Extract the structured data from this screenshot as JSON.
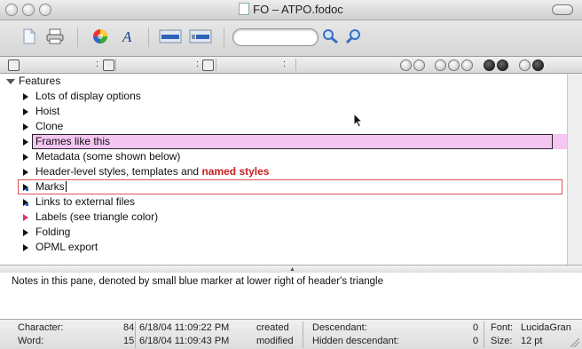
{
  "window": {
    "title": "FO – ATPO.fodoc"
  },
  "toolbar": {
    "icons": [
      "new-document-icon",
      "print-icon",
      "colors-icon",
      "fonts-icon",
      "insert-row-icon",
      "insert-child-icon",
      "search-field",
      "find-icon",
      "find-next-icon"
    ]
  },
  "columns": {
    "sep1": ":",
    "sep2": ":",
    "sep3": ":"
  },
  "outline": {
    "root": "Features",
    "rows": [
      {
        "label": "Lots of display options"
      },
      {
        "label": "Hoist"
      },
      {
        "label": "Clone"
      },
      {
        "label": "Frames like this"
      },
      {
        "label": "Metadata (some shown below)"
      },
      {
        "label": "Header-level styles, templates and ",
        "emphasis": "named styles"
      },
      {
        "label": "Marks"
      },
      {
        "label": "Links to external files"
      },
      {
        "label": "Labels (see triangle color)"
      },
      {
        "label": "Folding"
      },
      {
        "label": "OPML export"
      }
    ]
  },
  "notes": {
    "text": "Notes in this pane, denoted by small blue marker at lower right of header's triangle"
  },
  "status": {
    "char_label": "Character:",
    "char_value": "84",
    "word_label": "Word:",
    "word_value": "15",
    "created_date": "6/18/04 11:09:22 PM",
    "created_label": "created",
    "modified_date": "6/18/04 11:09:43 PM",
    "modified_label": "modified",
    "desc_label": "Descendant:",
    "desc_value": "0",
    "hidden_label": "Hidden descendant:",
    "hidden_value": "0",
    "font_label": "Font:",
    "font_value": "LucidaGran",
    "size_label": "Size:",
    "size_value": "12 pt"
  },
  "colors": {
    "frame_fill": "#f6c6f2",
    "mark_border": "#e05050",
    "named_style": "#c81f1f",
    "label_triangle": "#e0307a"
  }
}
